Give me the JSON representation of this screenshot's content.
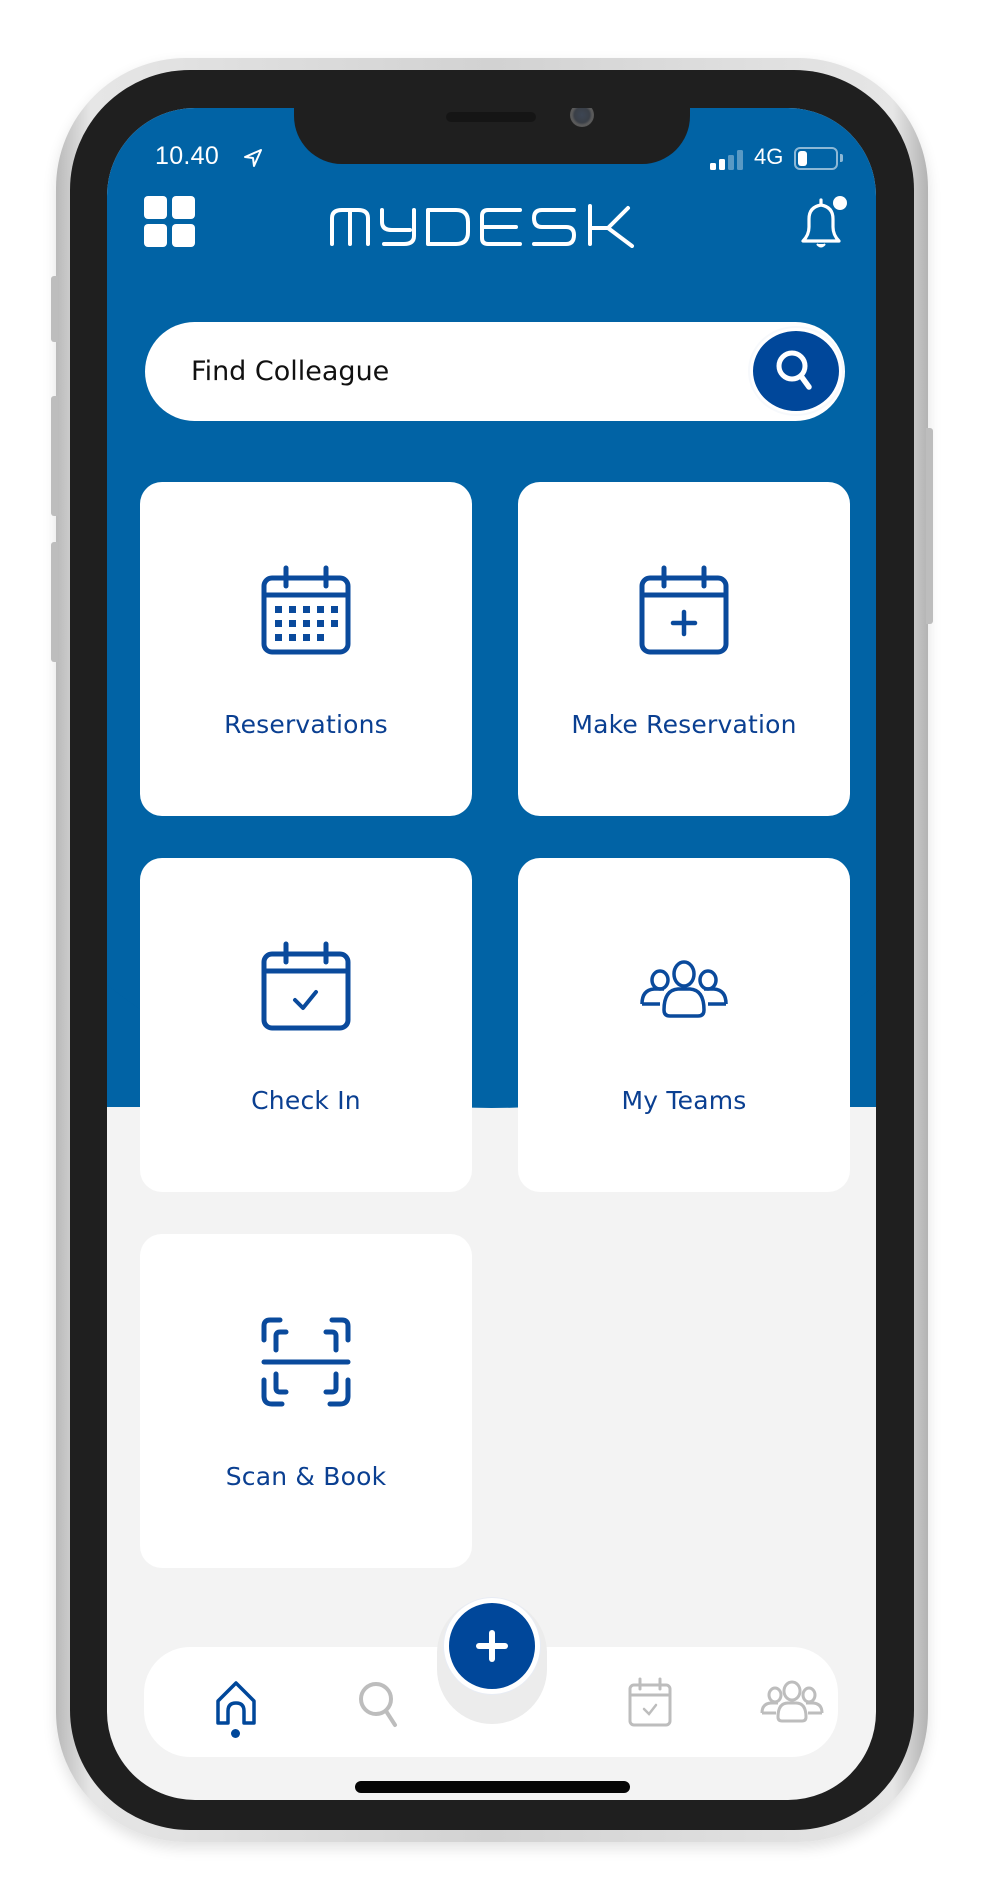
{
  "status_bar": {
    "time": "10.40",
    "location_icon": "location-arrow-icon",
    "network": "4G",
    "signal_bars_total": 4,
    "signal_bars_active": 2,
    "battery_level": 0.25
  },
  "header": {
    "menu_icon": "grid-menu-icon",
    "logo_text": "mydesk",
    "notification_icon": "bell-icon",
    "has_notification": true
  },
  "search": {
    "placeholder": "Find Colleague",
    "value": "",
    "button_icon": "search-icon"
  },
  "tiles": [
    {
      "label": "Reservations",
      "icon": "calendar-grid-icon"
    },
    {
      "label": "Make Reservation",
      "icon": "calendar-plus-icon"
    },
    {
      "label": "Check In",
      "icon": "calendar-check-icon"
    },
    {
      "label": "My Teams",
      "icon": "team-icon"
    },
    {
      "label": "Scan & Book",
      "icon": "scan-icon"
    }
  ],
  "bottom_nav": {
    "items": [
      {
        "icon": "home-icon",
        "active": true
      },
      {
        "icon": "search-icon",
        "active": false
      },
      {
        "icon": "add-icon",
        "active": false,
        "fab": true
      },
      {
        "icon": "calendar-check-icon",
        "active": false
      },
      {
        "icon": "team-icon",
        "active": false
      }
    ]
  },
  "colors": {
    "brand_blue": "#0163a5",
    "accent_navy": "#00479a",
    "tile_text": "#0a3f91",
    "inactive_icon": "#bdbdbd",
    "screen_bg": "#f3f3f3"
  }
}
